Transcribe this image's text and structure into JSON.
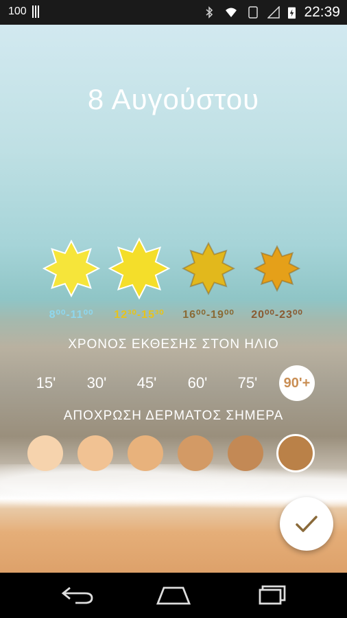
{
  "status_bar": {
    "battery_left": "100",
    "time": "22:39"
  },
  "date_title": "8  Αυγούστου",
  "sun_periods": [
    {
      "label": "8⁰⁰-11⁰⁰",
      "color": "#8fd7ee",
      "fill": "#f6e53a",
      "selected": false
    },
    {
      "label": "12³⁰-15³⁰",
      "color": "#e7c31c",
      "fill": "#f4de2a",
      "selected": false
    },
    {
      "label": "16⁰⁰-19⁰⁰",
      "color": "#8a6a35",
      "fill": "#e2b81c",
      "selected": false
    },
    {
      "label": "20⁰⁰-23⁰⁰",
      "color": "#8a5a32",
      "fill": "#e5a019",
      "selected": false
    }
  ],
  "exposure": {
    "title": "ΧΡΟΝΟΣ ΕΚΘΕΣΗΣ ΣΤΟΝ ΗΛΙΟ",
    "options": [
      "15'",
      "30'",
      "45'",
      "60'",
      "75'",
      "90'+"
    ],
    "selected": "90'+"
  },
  "skin": {
    "title": "ΑΠΟΧΡΩΣΗ ΔΕΡΜΑΤΟΣ ΣΗΜΕΡΑ",
    "tones": [
      "#f6d3ad",
      "#f1c293",
      "#e8b27c",
      "#d39a65",
      "#c38955",
      "#ba8148"
    ],
    "selected_index": 5
  },
  "colors": {
    "accent": "#c98e54",
    "check": "#8a6a3a"
  },
  "icons": {
    "confirm": "check-icon",
    "back": "back-icon",
    "home": "home-icon",
    "recents": "recents-icon"
  }
}
